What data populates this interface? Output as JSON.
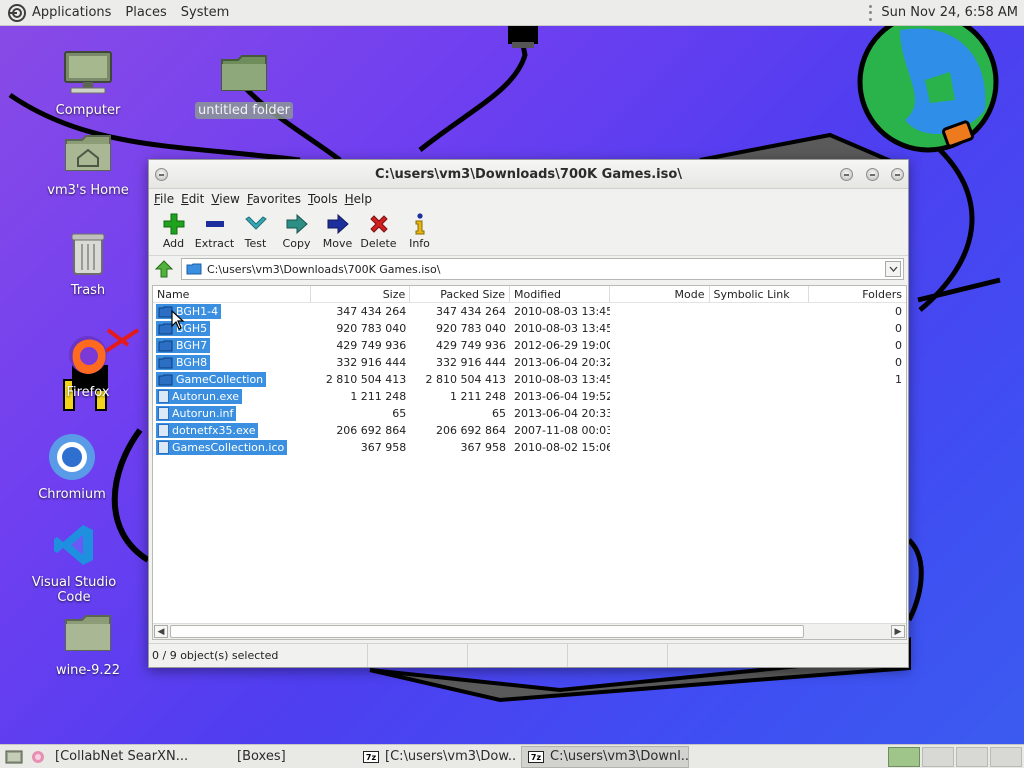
{
  "top_panel": {
    "menus": [
      "Applications",
      "Places",
      "System"
    ],
    "clock": "Sun Nov 24,  6:58 AM"
  },
  "desktop_icons": [
    {
      "label": "Computer",
      "icon": "computer-icon"
    },
    {
      "label": "untitled folder",
      "icon": "folder-icon",
      "selected": true
    },
    {
      "label": "vm3's Home",
      "icon": "home-folder-icon"
    },
    {
      "label": "Trash",
      "icon": "trash-icon"
    },
    {
      "label": "Firefox",
      "icon": "firefox-icon"
    },
    {
      "label": "Chromium",
      "icon": "chromium-icon"
    },
    {
      "label": "Visual Studio Code",
      "icon": "vscode-icon"
    },
    {
      "label": "wine-9.22",
      "icon": "folder-icon"
    }
  ],
  "window": {
    "title": "C:\\users\\vm3\\Downloads\\700K Games.iso\\",
    "menu": [
      "File",
      "Edit",
      "View",
      "Favorites",
      "Tools",
      "Help"
    ],
    "toolbar": [
      {
        "label": "Add",
        "icon": "plus-icon",
        "color": "#1fa31f"
      },
      {
        "label": "Extract",
        "icon": "minus-icon",
        "color": "#1d2f9c"
      },
      {
        "label": "Test",
        "icon": "check-icon",
        "color": "#36a8b5"
      },
      {
        "label": "Copy",
        "icon": "arrow-right-icon",
        "color": "#2c8e84"
      },
      {
        "label": "Move",
        "icon": "arrow-right-icon",
        "color": "#1d2f9c"
      },
      {
        "label": "Delete",
        "icon": "x-icon",
        "color": "#d21f1f"
      },
      {
        "label": "Info",
        "icon": "info-icon",
        "color": "#d6a90f"
      }
    ],
    "address": "C:\\users\\vm3\\Downloads\\700K Games.iso\\",
    "columns": {
      "name": "Name",
      "size": "Size",
      "packed": "Packed Size",
      "modified": "Modified",
      "mode": "Mode",
      "symlink": "Symbolic Link",
      "folders": "Folders"
    },
    "rows": [
      {
        "name": "BGH1-4",
        "type": "folder",
        "size": "347 434 264",
        "packed": "347 434 264",
        "modified": "2010-08-03 13:45",
        "folders": "0"
      },
      {
        "name": "BGH5",
        "type": "folder",
        "size": "920 783 040",
        "packed": "920 783 040",
        "modified": "2010-08-03 13:45",
        "folders": "0"
      },
      {
        "name": "BGH7",
        "type": "folder",
        "size": "429 749 936",
        "packed": "429 749 936",
        "modified": "2012-06-29 19:00",
        "folders": "0"
      },
      {
        "name": "BGH8",
        "type": "folder",
        "size": "332 916 444",
        "packed": "332 916 444",
        "modified": "2013-06-04 20:32",
        "folders": "0"
      },
      {
        "name": "GameCollection",
        "type": "folder",
        "size": "2 810 504 413",
        "packed": "2 810 504 413",
        "modified": "2010-08-03 13:45",
        "folders": "1"
      },
      {
        "name": "Autorun.exe",
        "type": "file",
        "size": "1 211 248",
        "packed": "1 211 248",
        "modified": "2013-06-04 19:52",
        "folders": ""
      },
      {
        "name": "Autorun.inf",
        "type": "file",
        "size": "65",
        "packed": "65",
        "modified": "2013-06-04 20:33",
        "folders": ""
      },
      {
        "name": "dotnetfx35.exe",
        "type": "file",
        "size": "206 692 864",
        "packed": "206 692 864",
        "modified": "2007-11-08 00:03",
        "folders": ""
      },
      {
        "name": "GamesCollection.ico",
        "type": "file",
        "size": "367 958",
        "packed": "367 958",
        "modified": "2010-08-02 15:06",
        "folders": ""
      }
    ],
    "status": "0 / 9 object(s) selected"
  },
  "taskbar": {
    "items": [
      {
        "label": "[CollabNet SearXN...",
        "icon": "browser-icon"
      },
      {
        "label": "[Boxes]",
        "icon": ""
      },
      {
        "label": "[C:\\users\\vm3\\Dow...",
        "icon": "7zip-icon"
      },
      {
        "label": "C:\\users\\vm3\\Downl...",
        "icon": "7zip-icon",
        "active": true
      }
    ],
    "workspaces": 4,
    "active_workspace": 1
  },
  "colors": {
    "selection": "#3a8fe0",
    "desktop_gradient_start": "#8a4be6",
    "desktop_gradient_end": "#3b5cf0"
  }
}
